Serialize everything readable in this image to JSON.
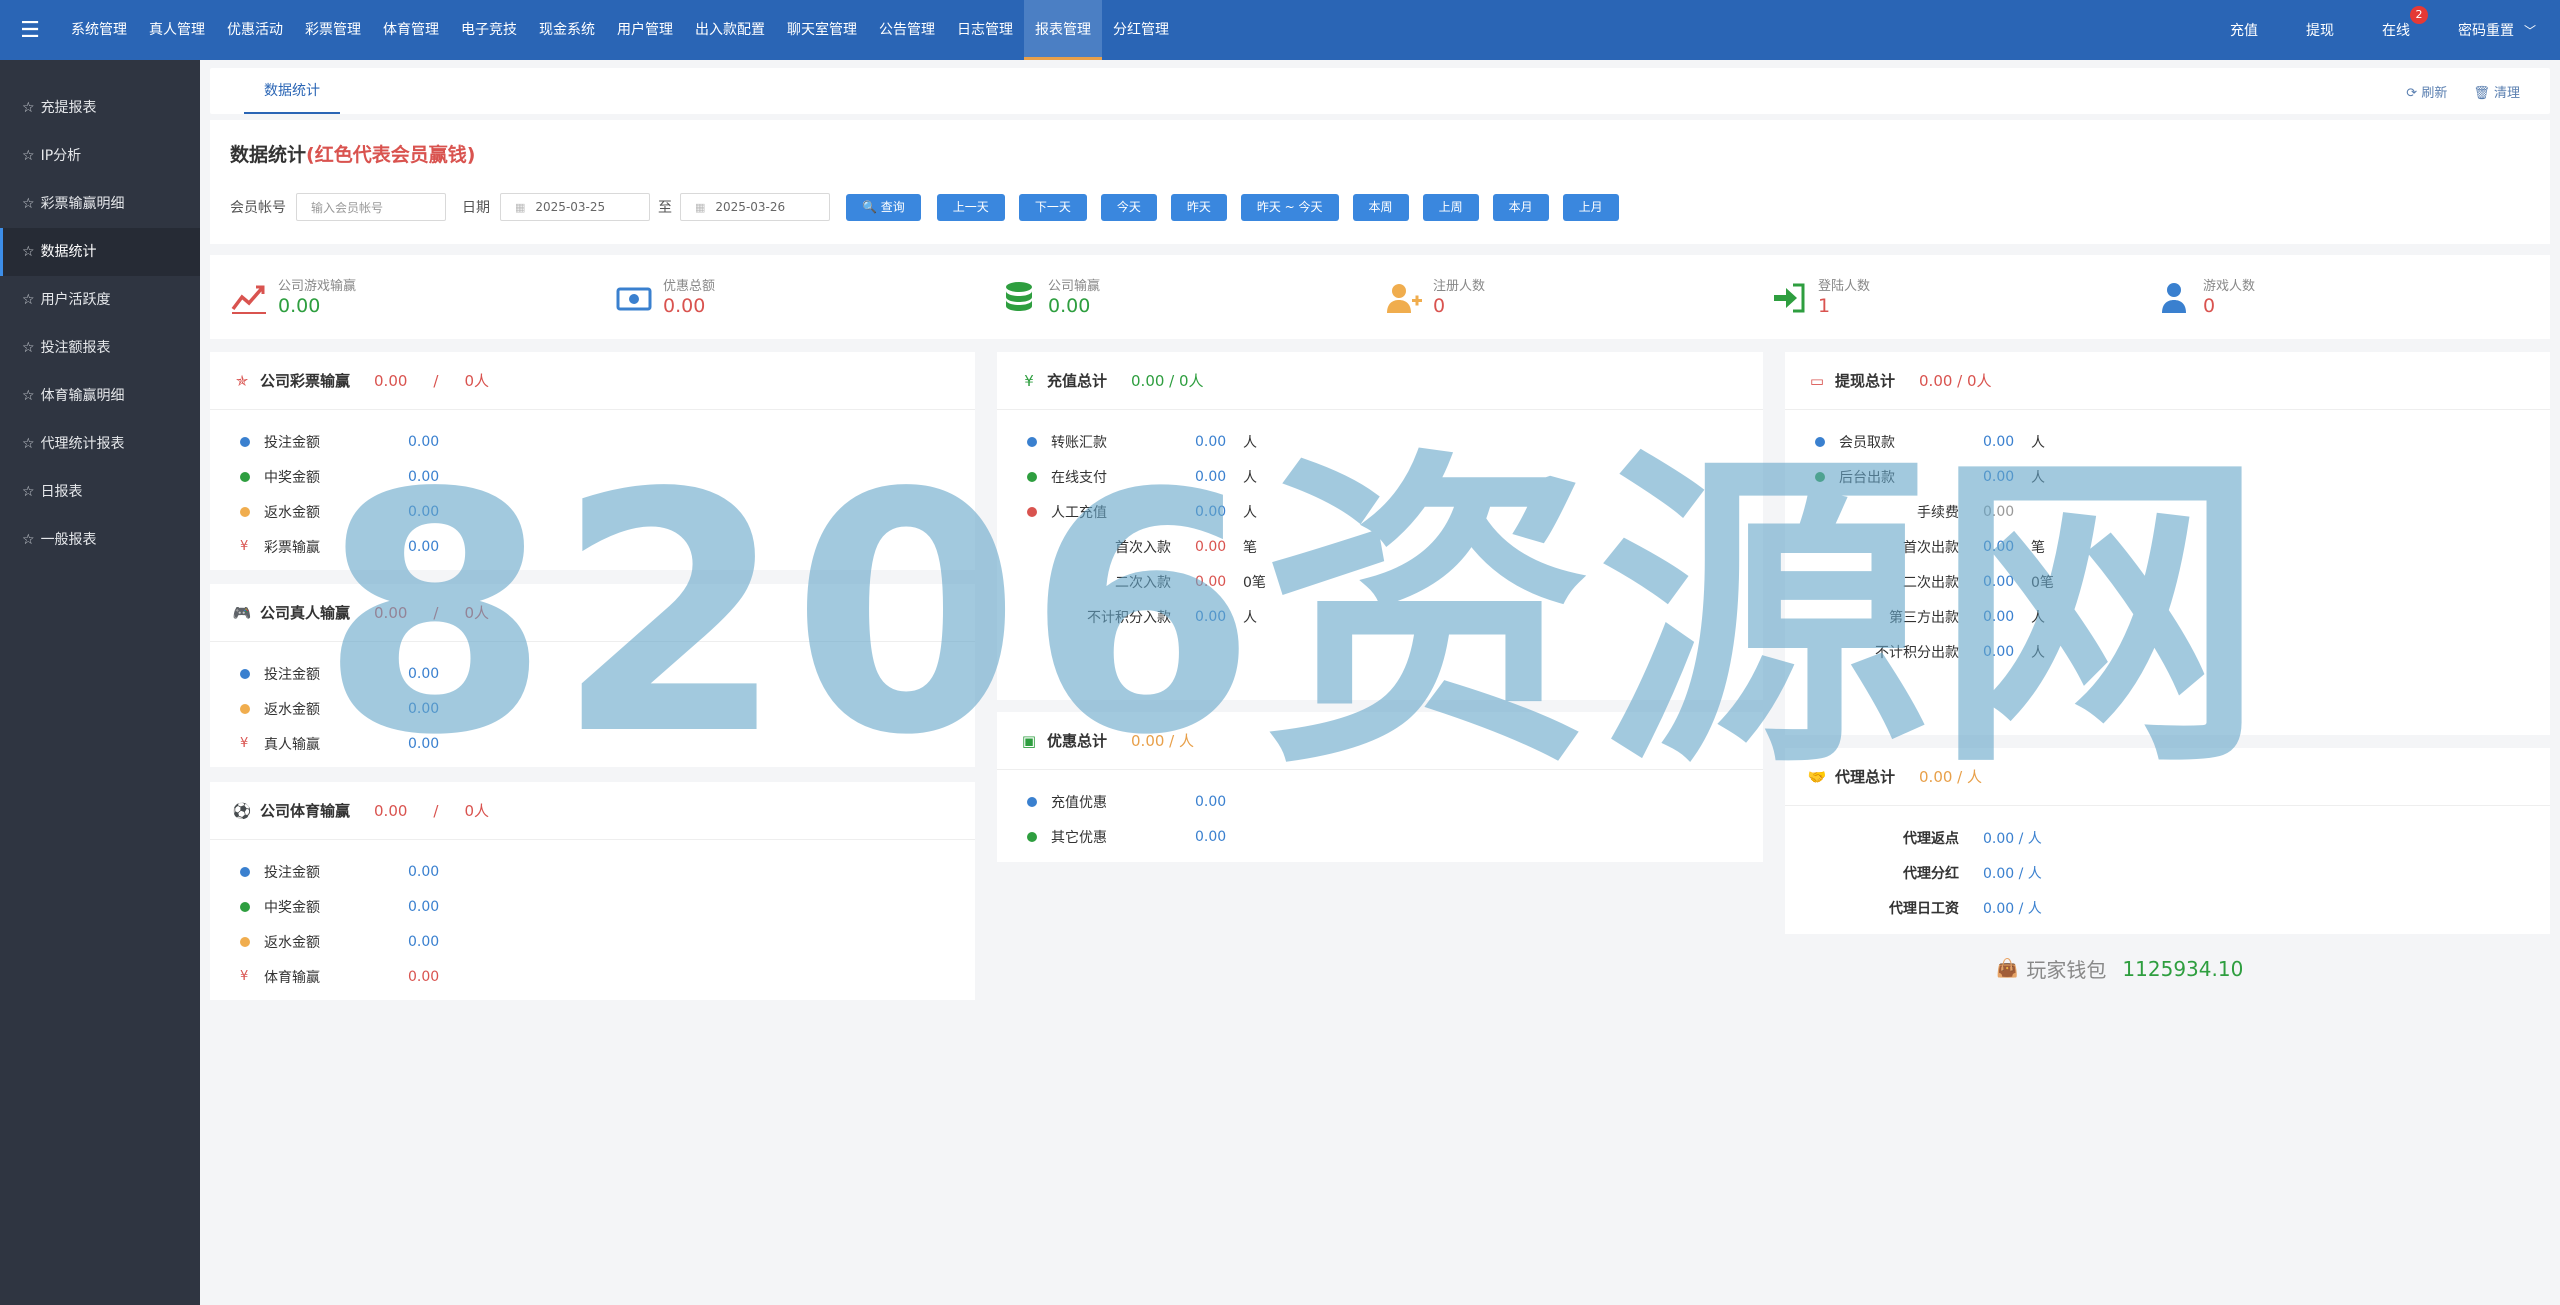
{
  "topnav": {
    "menu_icon": "hamburger-icon",
    "items": [
      "系统管理",
      "真人管理",
      "优惠活动",
      "彩票管理",
      "体育管理",
      "电子竞技",
      "现金系统",
      "用户管理",
      "出入款配置",
      "聊天室管理",
      "公告管理",
      "日志管理",
      "报表管理",
      "分红管理"
    ],
    "active_index": 12,
    "right": {
      "recharge": "充值",
      "withdraw": "提现",
      "online": "在线",
      "online_badge": "2",
      "password_reset": "密码重置"
    }
  },
  "sidebar": {
    "items": [
      "充提报表",
      "IP分析",
      "彩票输赢明细",
      "数据统计",
      "用户活跃度",
      "投注额报表",
      "体育输赢明细",
      "代理统计报表",
      "日报表",
      "一般报表"
    ],
    "active_index": 3
  },
  "tabbar": {
    "tab": "数据统计",
    "refresh": "刷新",
    "clear": "清理"
  },
  "filter": {
    "title": "数据统计",
    "title_note": "(红色代表会员赢钱)",
    "member_label": "会员帐号",
    "member_placeholder": "输入会员帐号",
    "date_label": "日期",
    "date_from": "2025-03-25",
    "to_label": "至",
    "date_to": "2025-03-26",
    "buttons": [
      "查询",
      "上一天",
      "下一天",
      "今天",
      "昨天",
      "昨天 ~ 今天",
      "本周",
      "上周",
      "本月",
      "上月"
    ]
  },
  "stats": [
    {
      "label": "公司游戏输赢",
      "value": "0.00",
      "color": "#2e9e3f"
    },
    {
      "label": "优惠总额",
      "value": "0.00",
      "color": "#d9534f"
    },
    {
      "label": "公司输赢",
      "value": "0.00",
      "color": "#2e9e3f"
    },
    {
      "label": "注册人数",
      "value": "0",
      "color": "#d9534f"
    },
    {
      "label": "登陆人数",
      "value": "1",
      "color": "#d9534f"
    },
    {
      "label": "游戏人数",
      "value": "0",
      "color": "#d9534f"
    }
  ],
  "lottery": {
    "title": "公司彩票输赢",
    "amount": "0.00",
    "sep": "/",
    "people": "0人",
    "rows": [
      {
        "label": "投注金额",
        "value": "0.00"
      },
      {
        "label": "中奖金额",
        "value": "0.00"
      },
      {
        "label": "返水金额",
        "value": "0.00"
      },
      {
        "label": "彩票输赢",
        "value": "0.00"
      }
    ]
  },
  "live": {
    "title": "公司真人输赢",
    "amount": "0.00",
    "sep": "/",
    "people": "0人",
    "rows": [
      {
        "label": "投注金额",
        "value": "0.00"
      },
      {
        "label": "返水金额",
        "value": "0.00"
      },
      {
        "label": "真人输赢",
        "value": "0.00"
      }
    ]
  },
  "sports": {
    "title": "公司体育输赢",
    "amount": "0.00",
    "sep": "/",
    "people": "0人",
    "rows": [
      {
        "label": "投注金额",
        "value": "0.00"
      },
      {
        "label": "中奖金额",
        "value": "0.00"
      },
      {
        "label": "返水金额",
        "value": "0.00"
      },
      {
        "label": "体育输赢",
        "value": "0.00"
      }
    ]
  },
  "deposit": {
    "title": "充值总计",
    "summary": "0.00 / 0人",
    "rows": [
      {
        "label": "转账汇款",
        "value": "0.00",
        "unit": "人"
      },
      {
        "label": "在线支付",
        "value": "0.00",
        "unit": "人"
      },
      {
        "label": "人工充值",
        "value": "0.00",
        "unit": "人"
      },
      {
        "label": "首次入款",
        "value": "0.00",
        "unit": "笔"
      },
      {
        "label": "二次入款",
        "value": "0.00",
        "unit": "0笔"
      },
      {
        "label": "不计积分入款",
        "value": "0.00",
        "unit": "人"
      }
    ]
  },
  "promo": {
    "title": "优惠总计",
    "summary": "0.00 / 人",
    "rows": [
      {
        "label": "充值优惠",
        "value": "0.00"
      },
      {
        "label": "其它优惠",
        "value": "0.00"
      }
    ]
  },
  "withdrawal": {
    "title": "提现总计",
    "summary": "0.00 / 0人",
    "rows": [
      {
        "label": "会员取款",
        "value": "0.00",
        "unit": "人"
      },
      {
        "label": "后台出款",
        "value": "0.00",
        "unit": "人"
      },
      {
        "label": "手续费",
        "value": "0.00",
        "unit": ""
      },
      {
        "label": "首次出款",
        "value": "0.00",
        "unit": "笔"
      },
      {
        "label": "二次出款",
        "value": "0.00",
        "unit": "0笔"
      },
      {
        "label": "第三方出款",
        "value": "0.00",
        "unit": "人"
      },
      {
        "label": "不计积分出款",
        "value": "0.00",
        "unit": "人"
      }
    ]
  },
  "agent": {
    "title": "代理总计",
    "summary": "0.00 / 人",
    "rows": [
      {
        "label": "代理返点",
        "value": "0.00 / 人"
      },
      {
        "label": "代理分红",
        "value": "0.00 / 人"
      },
      {
        "label": "代理日工资",
        "value": "0.00 / 人"
      }
    ]
  },
  "wallet": {
    "label": "玩家钱包",
    "value": "1125934.10"
  },
  "watermark": "8206资源网",
  "colors": {
    "primary": "#2a65b5",
    "button": "#3a87de",
    "sidebar": "#2f3541",
    "win": "#2e9e3f",
    "loss": "#d9534f",
    "value": "#3a80cf"
  }
}
